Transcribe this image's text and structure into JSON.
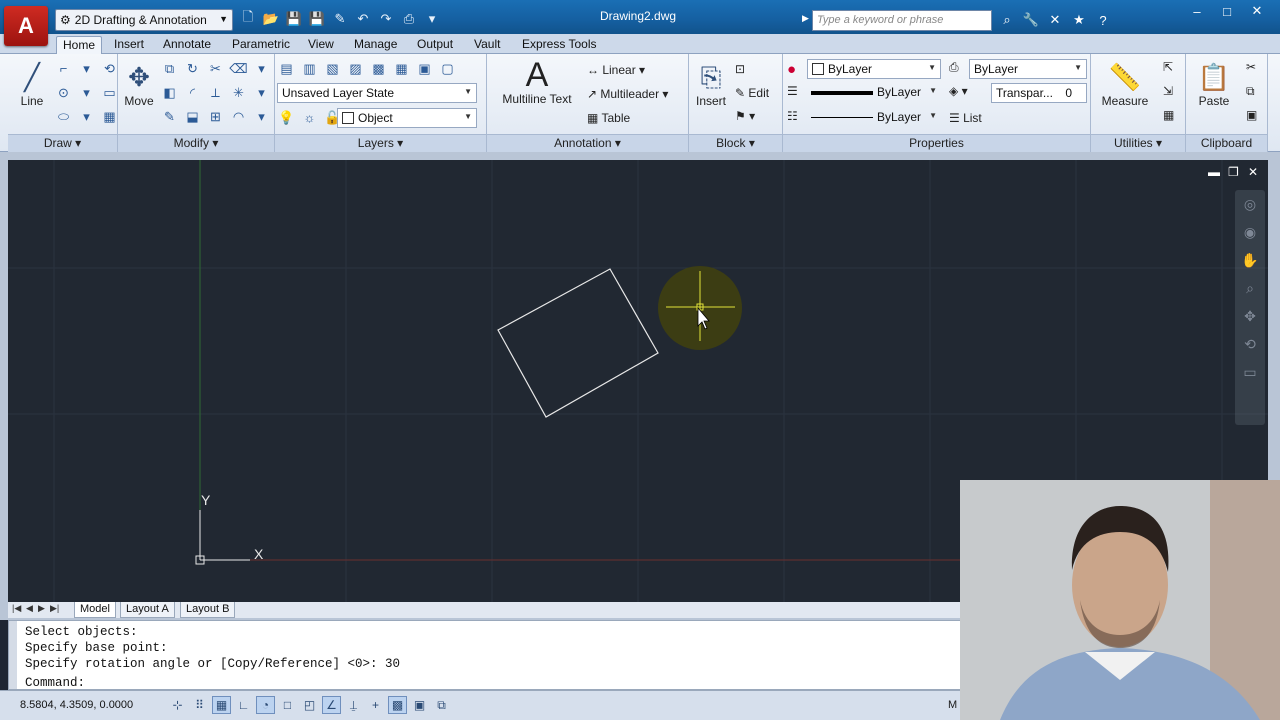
{
  "window": {
    "workspace": "2D Drafting & Annotation",
    "document_title": "Drawing2.dwg",
    "search_placeholder": "Type a keyword or phrase",
    "minimize": "–",
    "restore": "□",
    "close": "✕"
  },
  "tabs": [
    "Home",
    "Insert",
    "Annotate",
    "Parametric",
    "View",
    "Manage",
    "Output",
    "Vault",
    "Express Tools"
  ],
  "ribbon": {
    "draw": {
      "title": "Draw",
      "line": "Line"
    },
    "modify": {
      "title": "Modify",
      "move": "Move"
    },
    "layers": {
      "title": "Layers",
      "layer_state": "Unsaved Layer State",
      "layer": "Object"
    },
    "annotation": {
      "title": "Annotation",
      "mtext": "Multiline Text",
      "linear": "Linear",
      "multileader": "Multileader",
      "table": "Table"
    },
    "block": {
      "title": "Block",
      "insert": "Insert",
      "edit": "Edit"
    },
    "properties": {
      "title": "Properties",
      "color": "ByLayer",
      "lineweight": "ByLayer",
      "linetype": "ByLayer",
      "plotstyle": "ByLayer",
      "transparency": "Transpar...",
      "transparency_value": "0",
      "list": "List"
    },
    "utilities": {
      "title": "Utilities",
      "measure": "Measure"
    },
    "clipboard": {
      "title": "Clipboard",
      "paste": "Paste"
    }
  },
  "canvas": {
    "ucs_x": "X",
    "ucs_y": "Y"
  },
  "layout_tabs": [
    "Model",
    "Layout A",
    "Layout B"
  ],
  "command_history": [
    "Select objects:",
    "Specify base point:",
    "Specify rotation angle or [Copy/Reference] <0>: 30"
  ],
  "command_prompt": "Command:",
  "status": {
    "coordinates": "8.5804, 4.3509, 0.0000",
    "model_label": "M"
  },
  "colors": {
    "canvas": "#212832",
    "ribbon": "#dfe7f2",
    "titlebar": "#155fa0",
    "app_button": "#c0201a"
  }
}
